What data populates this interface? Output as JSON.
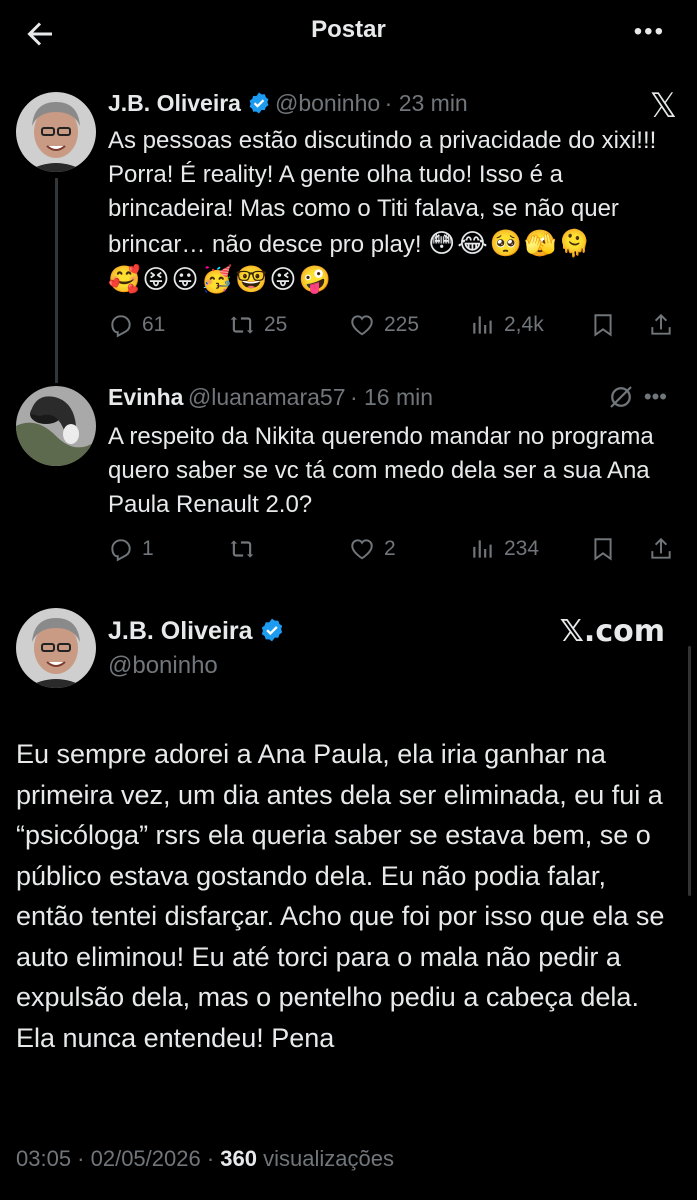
{
  "header": {
    "title": "Postar"
  },
  "tweet1": {
    "name": "J.B. Oliveira",
    "handle": "@boninho",
    "time": "· 23 min",
    "text": "As pessoas estão discutindo a privacidade do xixi!!! Porra! É reality! A gente olha tudo! Isso é a brincadeira! Mas como o Titi falava, se não quer brincar… não desce pro play!",
    "emojis_inline": [
      "😳",
      "😂",
      "🥺",
      "🫣",
      "🫠"
    ],
    "emojis_line2": [
      "🥰",
      "😝",
      "😛",
      "🥳",
      "🤓",
      "😜",
      "🤪"
    ],
    "replies": "61",
    "reposts": "25",
    "likes": "225",
    "views": "2,4k"
  },
  "tweet2": {
    "name": "Evinha",
    "handle": "@luanamara57",
    "time": "· 16 min",
    "text": "A respeito da Nikita querendo mandar no programa quero saber se vc tá com medo dela ser a sua Ana Paula Renault 2.0?",
    "replies": "1",
    "likes": "2",
    "views": "234"
  },
  "main": {
    "name": "J.B. Oliveira",
    "handle": "@boninho",
    "watermark": "𝕏.com",
    "text": "Eu sempre adorei a Ana Paula, ela iria ganhar na primeira vez, um dia antes dela ser eliminada, eu fui a “psicóloga” rsrs ela queria saber se estava bem, se o público estava gostando dela. Eu não podia falar, então tentei disfarçar. Acho que foi por isso que ela se auto eliminou! Eu até torci para o mala não pedir a expulsão dela, mas o pentelho pediu a cabeça dela. Ela nunca entendeu! Pena",
    "timestamp": "03:05 · 02/05/2026 ·",
    "views_count": "360",
    "views_label": "visualizações"
  },
  "colors": {
    "accent": "#1d9bf0",
    "muted": "#71767b",
    "text": "#e7e9ea"
  }
}
